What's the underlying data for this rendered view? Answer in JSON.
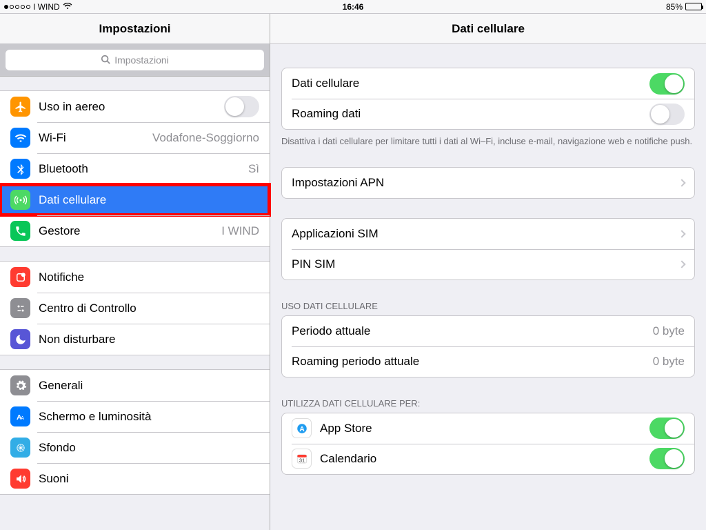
{
  "statusbar": {
    "carrier": "I WIND",
    "time": "16:46",
    "battery_pct": "85%"
  },
  "sidebar": {
    "title": "Impostazioni",
    "search_placeholder": "Impostazioni",
    "g1": {
      "airplane": "Uso in aereo",
      "wifi": "Wi-Fi",
      "wifi_val": "Vodafone-Soggiorno",
      "bt": "Bluetooth",
      "bt_val": "Sì",
      "cellular": "Dati cellulare",
      "carrier": "Gestore",
      "carrier_val": "I WIND"
    },
    "g2": {
      "notif": "Notifiche",
      "cc": "Centro di Controllo",
      "dnd": "Non disturbare"
    },
    "g3": {
      "general": "Generali",
      "display": "Schermo e luminosità",
      "wall": "Sfondo",
      "sounds": "Suoni"
    }
  },
  "detail": {
    "title": "Dati cellulare",
    "top": {
      "cellular_data": "Dati cellulare",
      "roaming": "Roaming dati",
      "footer": "Disattiva i dati cellulare per limitare tutti i dati al Wi–Fi, incluse e-mail, navigazione web e notifiche push."
    },
    "apn": "Impostazioni APN",
    "sim_apps": "Applicazioni SIM",
    "sim_pin": "PIN SIM",
    "usage_header": "USO DATI CELLULARE",
    "usage": {
      "current": "Periodo attuale",
      "current_val": "0 byte",
      "roaming": "Roaming periodo attuale",
      "roaming_val": "0 byte"
    },
    "apps_header": "UTILIZZA DATI CELLULARE PER:",
    "apps": {
      "appstore": "App Store",
      "calendar": "Calendario"
    }
  }
}
